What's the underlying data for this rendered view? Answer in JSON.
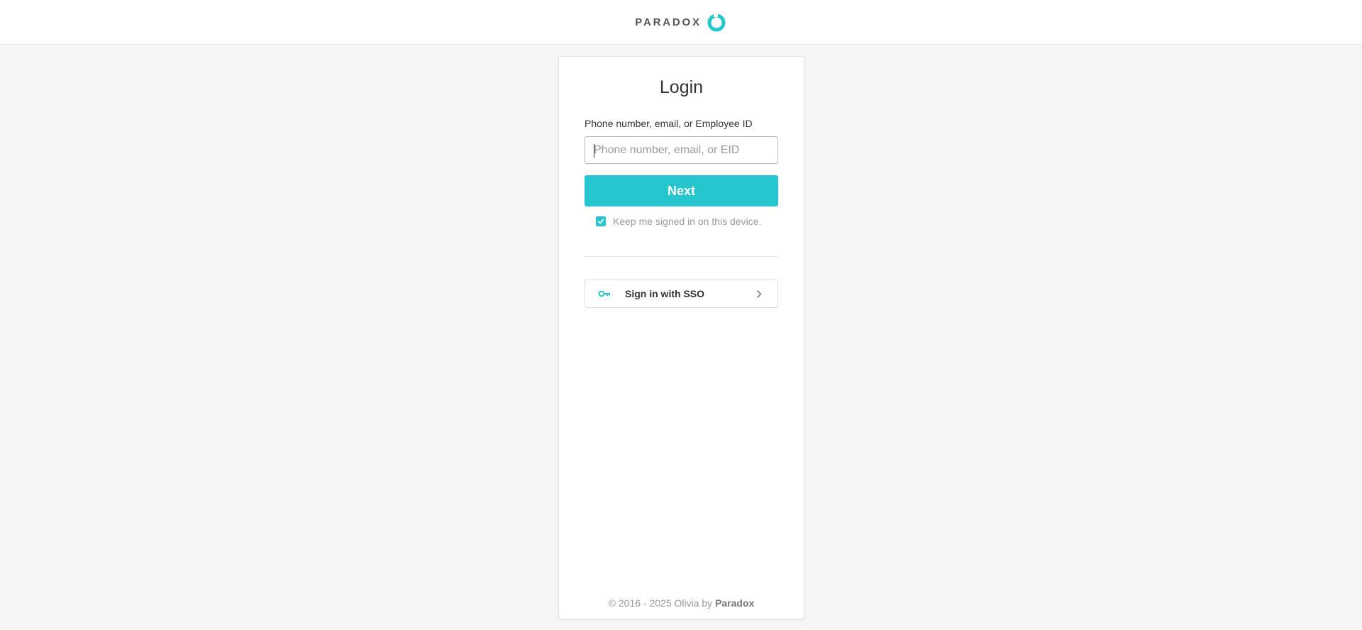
{
  "header": {
    "logo_text": "PARADOX",
    "accent": "#26c6cf"
  },
  "login": {
    "title": "Login",
    "field_label": "Phone number, email, or Employee ID",
    "field_value": "",
    "field_placeholder": "Phone number, email, or EID",
    "next_label": "Next",
    "keep_signed_in_label": "Keep me signed in on this device.",
    "keep_signed_in_checked": true
  },
  "sso": {
    "label": "Sign in with SSO",
    "icon": "key-icon",
    "chevron": "chevron-right-icon"
  },
  "footer": {
    "prefix": "© 2016 - 2025 Olivia by",
    "brand": "Paradox"
  },
  "colors": {
    "page_bg": "#f6f6f6",
    "card_bg": "#ffffff",
    "primary": "#26c6cf",
    "muted_text": "#9a9a9a"
  }
}
